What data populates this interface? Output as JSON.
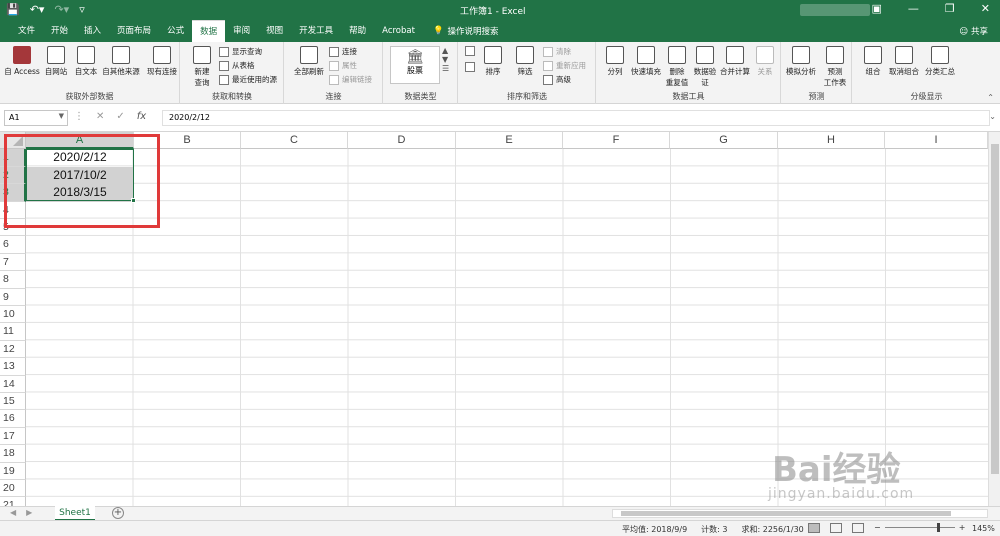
{
  "window": {
    "title": "工作簿1 - Excel"
  },
  "tabs": [
    "文件",
    "开始",
    "插入",
    "页面布局",
    "公式",
    "数据",
    "审阅",
    "视图",
    "开发工具",
    "帮助",
    "Acrobat"
  ],
  "active_tab": "数据",
  "tell_me": "操作说明搜索",
  "share": "共享",
  "ribbon": {
    "get_data": {
      "buttons": [
        "自 Access",
        "自网站",
        "自文本",
        "自其他来源",
        "现有连接"
      ],
      "label": "获取外部数据"
    },
    "transform": {
      "new_query_1": "新建",
      "new_query_2": "查询",
      "show_queries": "显示查询",
      "from_table": "从表格",
      "recent_sources": "最近使用的源",
      "label": "获取和转换"
    },
    "connections": {
      "refresh_all": "全部刷新",
      "connections": "连接",
      "properties": "属性",
      "edit_links": "编辑链接",
      "label": "连接"
    },
    "data_types": {
      "stocks": "股票",
      "label": "数据类型"
    },
    "sort_filter": {
      "sort": "排序",
      "filter": "筛选",
      "clear": "清除",
      "reapply": "重新应用",
      "advanced": "高级",
      "label": "排序和筛选"
    },
    "data_tools": {
      "text_to_columns": "分列",
      "flash_fill": "快速填充",
      "remove_dup_1": "删除",
      "remove_dup_2": "重复值",
      "validation_1": "数据验",
      "validation_2": "证",
      "consolidate": "合并计算",
      "relationships": "关系",
      "label": "数据工具"
    },
    "forecast": {
      "what_if": "模拟分析",
      "forecast_sheet_1": "预测",
      "forecast_sheet_2": "工作表",
      "label": "预测"
    },
    "outline": {
      "group": "组合",
      "ungroup": "取消组合",
      "subtotal": "分类汇总",
      "label": "分级显示"
    }
  },
  "formula_bar": {
    "name_box": "A1",
    "formula": "2020/2/12",
    "fx": "fx"
  },
  "columns": [
    "A",
    "B",
    "C",
    "D",
    "E",
    "F",
    "G",
    "H",
    "I"
  ],
  "rows": [
    "1",
    "2",
    "3",
    "4",
    "5",
    "6",
    "7",
    "8",
    "9",
    "10",
    "11",
    "12",
    "13",
    "14",
    "15",
    "16",
    "17",
    "18",
    "19",
    "20",
    "21"
  ],
  "cells": {
    "A1": "2020/2/12",
    "A2": "2017/10/2",
    "A3": "2018/3/15"
  },
  "sheet_tabs": [
    "Sheet1"
  ],
  "status": {
    "average": "平均值: 2018/9/9",
    "count": "计数: 3",
    "sum": "求和: 2256/1/30",
    "zoom": "145%"
  },
  "watermark": {
    "brand": "Bai经验",
    "url": "jingyan.baidu.com"
  },
  "colors": {
    "accent": "#217346",
    "highlight_box": "#e03a3a",
    "selection_fill": "#d2d2d2"
  }
}
